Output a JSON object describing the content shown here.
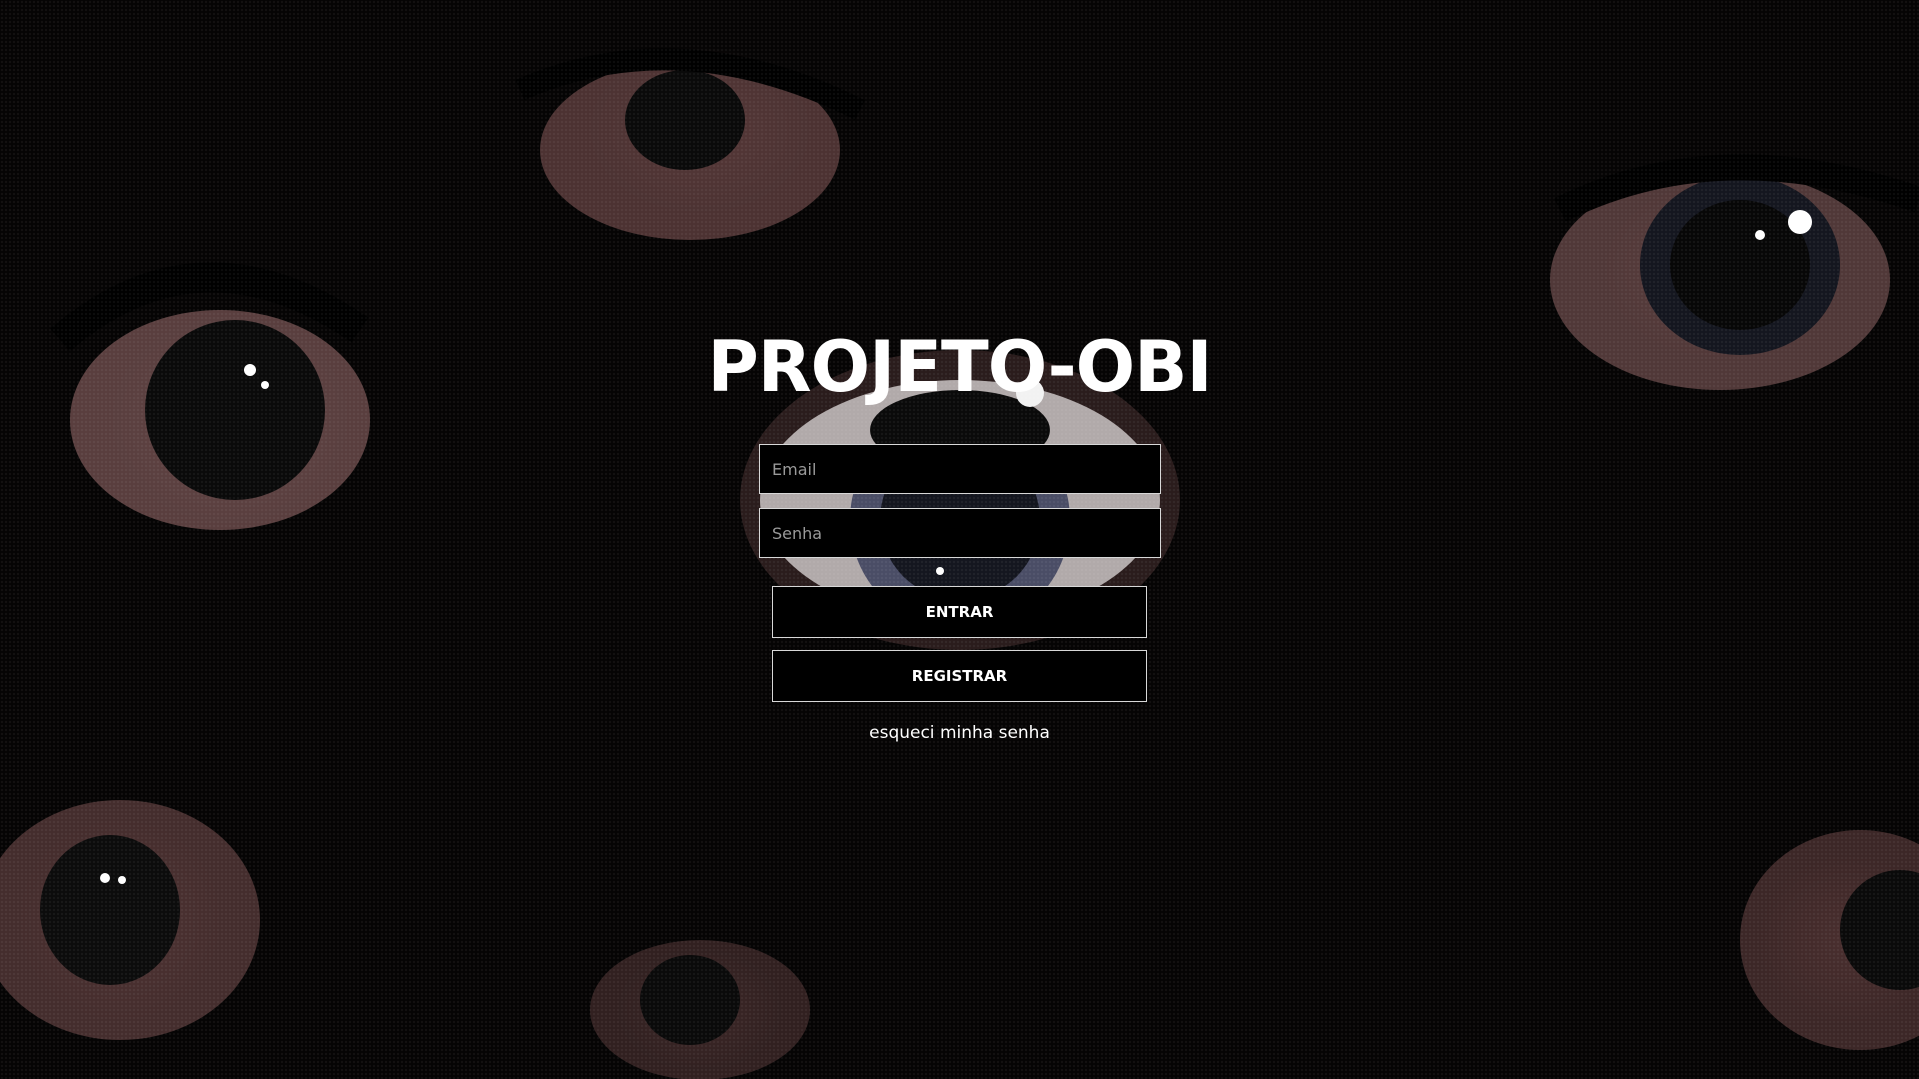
{
  "app": {
    "title": "PROJETO-OBI"
  },
  "login_form": {
    "email_placeholder": "Email",
    "email_value": "",
    "password_placeholder": "Senha",
    "password_value": "",
    "enter_label": "ENTRAR",
    "register_label": "REGISTRAR",
    "forgot_password_label": "esqueci minha senha"
  },
  "colors": {
    "background": "#050404",
    "text": "#ffffff",
    "border": "#d8d8d8",
    "placeholder": "#9a9a9a"
  }
}
